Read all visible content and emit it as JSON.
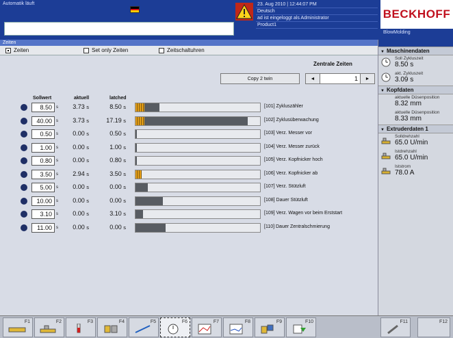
{
  "header": {
    "status": "Automatik läuft",
    "datetime": "23. Aug 2010 | 12:44:07 PM",
    "language": "Deutsch",
    "login": "ad ist eingeloggt als Administrator",
    "product": "Product1",
    "machine": "BlowMolding",
    "logo": "BECKHOFF"
  },
  "page": {
    "title": "Zeiten",
    "tabs": [
      {
        "label": "Zeiten",
        "checked": true
      },
      {
        "label": "Set only Zeiten",
        "checked": false
      },
      {
        "label": "Zeitschaltuhren",
        "checked": false
      }
    ]
  },
  "zentrale": {
    "title": "Zentrale Zeiten",
    "copy_label": "Copy 2 twin",
    "prev": "◄",
    "next": "►",
    "value": "1"
  },
  "columns": {
    "sollwert": "Sollwert",
    "aktuell": "aktuell",
    "latched": "latched"
  },
  "timers": [
    {
      "soll": "8.50",
      "akt": "3.73",
      "latched": "8.50",
      "label": "[101] Zykluszähler",
      "latch_pct": 0.07,
      "fill_pct": 0.19
    },
    {
      "soll": "40.00",
      "akt": "3.73",
      "latched": "17.19",
      "label": "[102] Zyklusüberwachung",
      "latch_pct": 0.07,
      "fill_pct": 0.9
    },
    {
      "soll": "0.50",
      "akt": "0.00",
      "latched": "0.50",
      "label": "[103] Verz. Messer vor",
      "latch_pct": 0.0,
      "fill_pct": 0.01
    },
    {
      "soll": "1.00",
      "akt": "0.00",
      "latched": "1.00",
      "label": "[104] Verz. Messer zurück",
      "latch_pct": 0.0,
      "fill_pct": 0.01
    },
    {
      "soll": "0.80",
      "akt": "0.00",
      "latched": "0.80",
      "label": "[105] Verz. Kopfnicker hoch",
      "latch_pct": 0.0,
      "fill_pct": 0.01
    },
    {
      "soll": "3.50",
      "akt": "2.94",
      "latched": "3.50",
      "label": "[106] Verz. Kopfnicker ab",
      "latch_pct": 0.05,
      "fill_pct": 0.0
    },
    {
      "soll": "5.00",
      "akt": "0.00",
      "latched": "0.00",
      "label": "[107] Verz. Stützluft",
      "latch_pct": 0.0,
      "fill_pct": 0.1
    },
    {
      "soll": "10.00",
      "akt": "0.00",
      "latched": "0.00",
      "label": "[108] Dauer Stützluft",
      "latch_pct": 0.0,
      "fill_pct": 0.22
    },
    {
      "soll": "3.10",
      "akt": "0.00",
      "latched": "3.10",
      "label": "[109] Verz. Wagen vor beim Erststart",
      "latch_pct": 0.0,
      "fill_pct": 0.06
    },
    {
      "soll": "11.00",
      "akt": "0.00",
      "latched": "0.00",
      "label": "[110] Dauer Zentralschmierung",
      "latch_pct": 0.0,
      "fill_pct": 0.24
    }
  ],
  "unit": "s",
  "sidebar": {
    "sections": [
      {
        "title": "Maschinendaten",
        "items": [
          {
            "label": "Soll Zykluszeit",
            "value": "8.50 s",
            "icon": "clock-icon"
          },
          {
            "label": "akt. Zykluszeit",
            "value": "3.09 s",
            "icon": "clock-icon"
          }
        ]
      },
      {
        "title": "Kopfdaten",
        "items": [
          {
            "label": "aktuelle Düsenposition",
            "value": "8.32 mm",
            "icon": ""
          },
          {
            "label": "aktuelle Düsenposition",
            "value": "8.33 mm",
            "icon": ""
          }
        ]
      },
      {
        "title": "Extruderdaten 1",
        "items": [
          {
            "label": "Solldrehzahl",
            "value": "65.0 U/min",
            "icon": "extruder-icon"
          },
          {
            "label": "Istdrehzahl",
            "value": "65.0 U/min",
            "icon": "extruder-icon"
          },
          {
            "label": "Iststrom",
            "value": "78.0 A",
            "icon": "extruder-icon"
          }
        ]
      }
    ]
  },
  "fkeys": [
    "F1",
    "F2",
    "F3",
    "F4",
    "F5",
    "F6",
    "F7",
    "F8",
    "F9",
    "F10",
    "F11",
    "F12"
  ]
}
